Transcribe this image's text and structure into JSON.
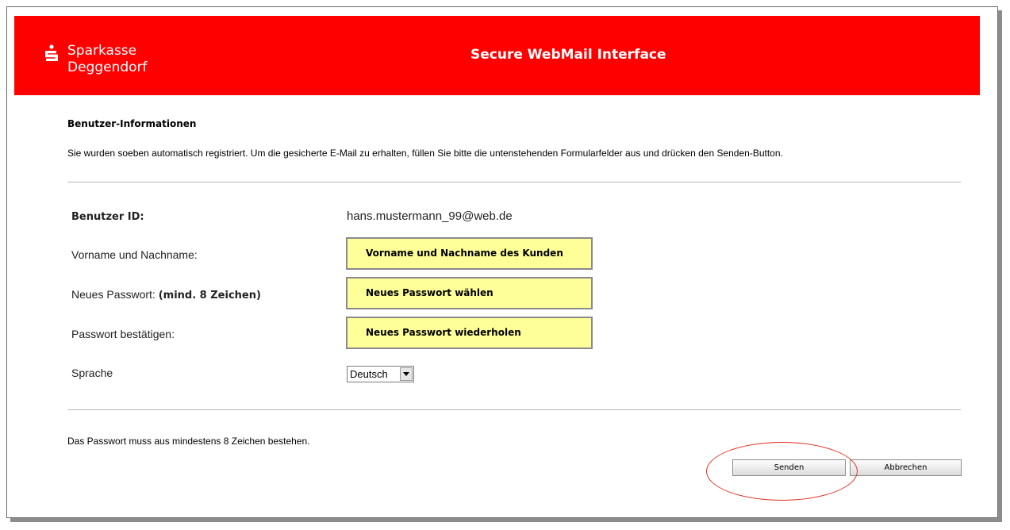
{
  "header": {
    "logo_line1": "Sparkasse",
    "logo_line2": "Deggendorf",
    "title": "Secure WebMail Interface",
    "brand_color": "#ff0000"
  },
  "section": {
    "title": "Benutzer-Informationen",
    "intro": "Sie wurden soeben automatisch registriert. Um die gesicherte E-Mail zu erhalten, füllen Sie bitte die untenstehenden Formularfelder aus und drücken den Senden-Button."
  },
  "form": {
    "user_id_label": "Benutzer ID:",
    "user_id_value": "hans.mustermann_99@web.de",
    "name_label": "Vorname und Nachname:",
    "name_value": "Vorname und Nachname des Kunden",
    "password_label": "Neues Passwort: ",
    "password_hint": "(mind. 8 Zeichen)",
    "password_value": "Neues Passwort wählen",
    "confirm_label": "Passwort bestätigen:",
    "confirm_value": "Neues Passwort wiederholen",
    "language_label": "Sprache",
    "language_selected": "Deutsch",
    "field_color": "#ffff99"
  },
  "footer": {
    "note": "Das Passwort muss aus mindestens 8 Zeichen bestehen.",
    "send_label": "Senden",
    "cancel_label": "Abbrechen"
  },
  "icons": {
    "logo": "sparkasse-s-icon",
    "dropdown": "chevron-down-icon"
  }
}
